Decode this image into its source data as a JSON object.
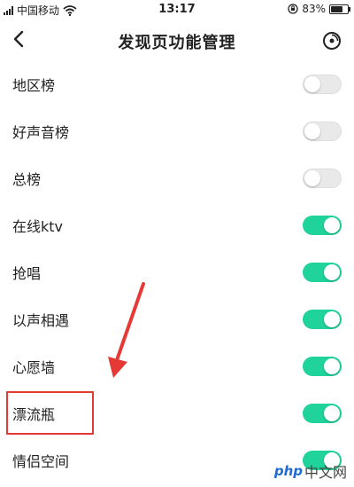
{
  "status_bar": {
    "carrier": "中国移动",
    "time": "13:17",
    "battery_text": "83%",
    "battery_level": 0.83,
    "icons": [
      "signal-icon",
      "wifi-icon",
      "rotation-lock-icon",
      "battery-icon"
    ]
  },
  "nav": {
    "title": "发现页功能管理",
    "back_icon": "back-chevron-icon",
    "action_icon": "disc-icon"
  },
  "items": [
    {
      "label": "地区榜",
      "enabled": false
    },
    {
      "label": "好声音榜",
      "enabled": false
    },
    {
      "label": "总榜",
      "enabled": false
    },
    {
      "label": "在线ktv",
      "enabled": true
    },
    {
      "label": "抢唱",
      "enabled": true
    },
    {
      "label": "以声相遇",
      "enabled": true
    },
    {
      "label": "心愿墙",
      "enabled": true
    },
    {
      "label": "漂流瓶",
      "enabled": true
    },
    {
      "label": "情侣空间",
      "enabled": true
    }
  ],
  "colors": {
    "toggle_on": "#1fd39a",
    "toggle_off": "#e9e9e9",
    "annotation": "#e53935"
  },
  "watermark": {
    "logo": "php",
    "text": "中文网"
  }
}
